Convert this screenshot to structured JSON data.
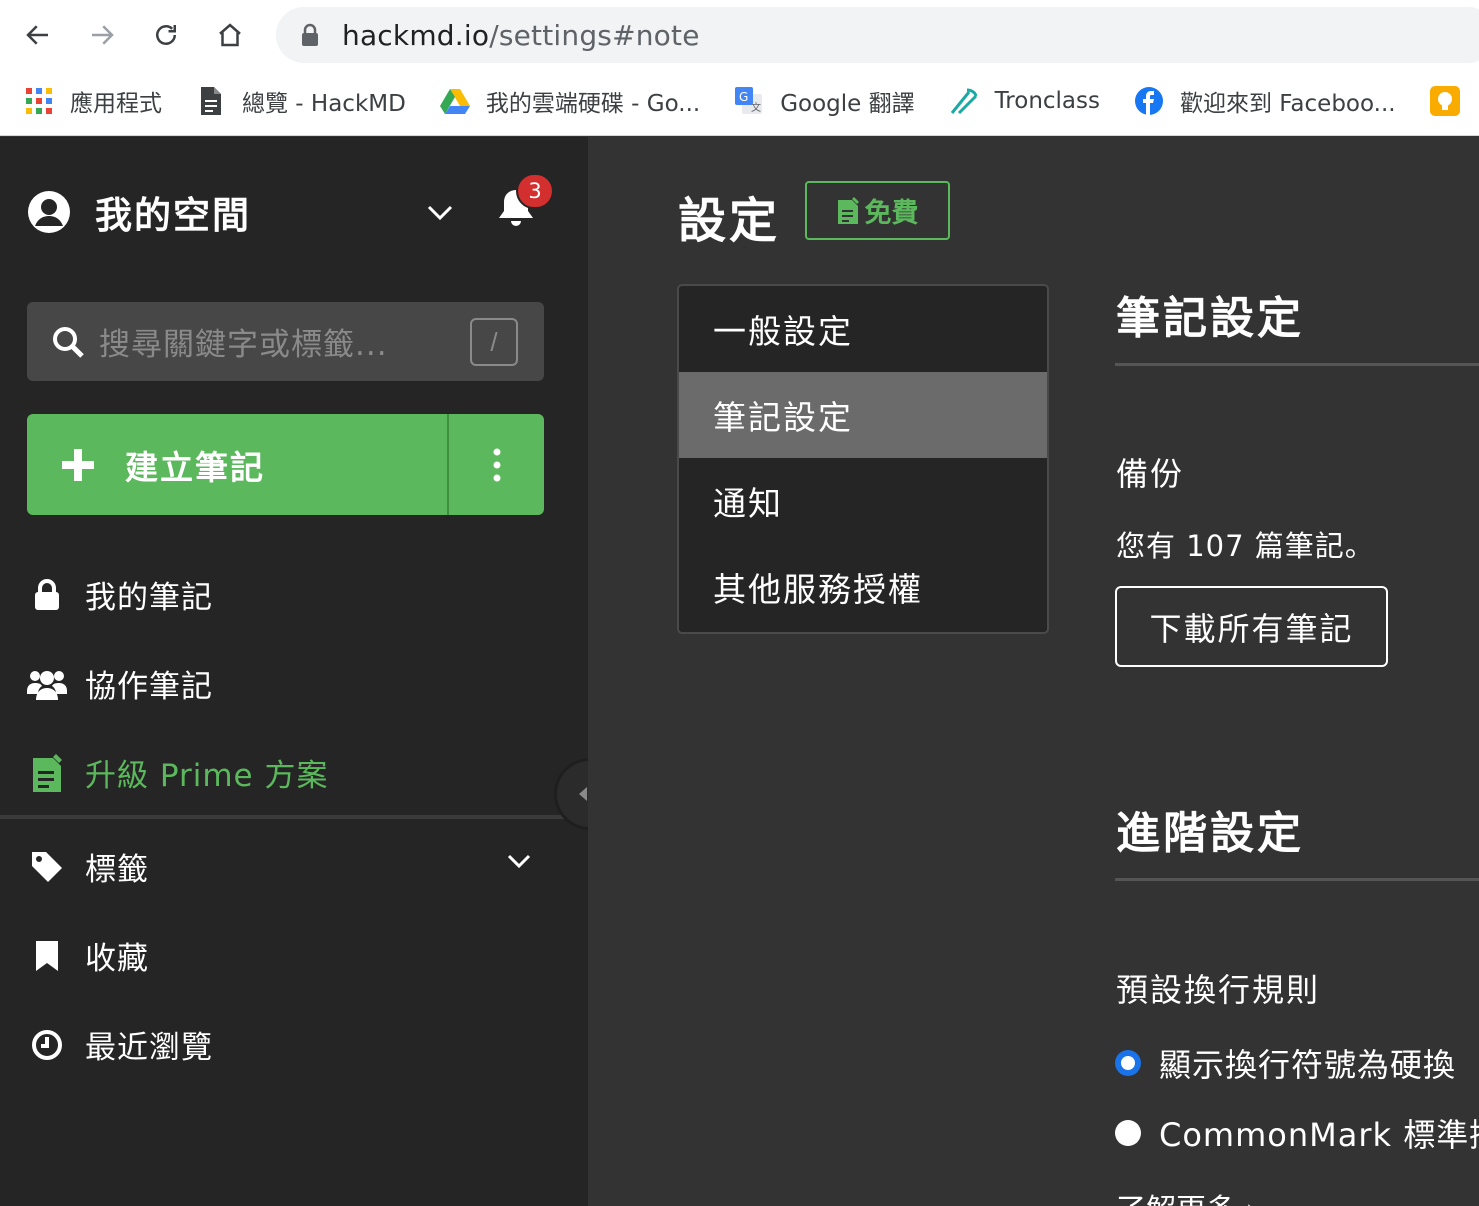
{
  "browser": {
    "url_host": "hackmd.io",
    "url_path": "/settings#note",
    "bookmarks": [
      {
        "label": "應用程式",
        "icon": "apps-grid-icon"
      },
      {
        "label": "總覽 - HackMD",
        "icon": "document-icon"
      },
      {
        "label": "我的雲端硬碟 - Go...",
        "icon": "google-drive-icon"
      },
      {
        "label": "Google 翻譯",
        "icon": "google-translate-icon"
      },
      {
        "label": "Tronclass",
        "icon": "tronclass-icon"
      },
      {
        "label": "歡迎來到 Faceboo...",
        "icon": "facebook-icon"
      }
    ]
  },
  "sidebar": {
    "workspace_title": "我的空間",
    "notification_count": "3",
    "search_placeholder": "搜尋關鍵字或標籤...",
    "search_shortcut": "/",
    "new_note_label": "建立筆記",
    "items": [
      {
        "label": "我的筆記",
        "icon": "lock-icon"
      },
      {
        "label": "協作筆記",
        "icon": "users-icon"
      },
      {
        "label": "升級 Prime 方案",
        "icon": "prime-note-icon"
      },
      {
        "label": "標籤",
        "icon": "tag-icon"
      },
      {
        "label": "收藏",
        "icon": "bookmark-icon"
      },
      {
        "label": "最近瀏覽",
        "icon": "clock-icon"
      }
    ]
  },
  "main": {
    "title": "設定",
    "plan_badge": "免費",
    "settings_nav": [
      {
        "label": "一般設定",
        "active": false
      },
      {
        "label": "筆記設定",
        "active": true
      },
      {
        "label": "通知",
        "active": false
      },
      {
        "label": "其他服務授權",
        "active": false
      }
    ],
    "note_settings": {
      "title": "筆記設定",
      "backup_label": "備份",
      "backup_text": "您有 107 篇筆記。",
      "download_button": "下載所有筆記"
    },
    "advanced_settings": {
      "title": "進階設定",
      "line_break_label": "預設換行規則",
      "options": [
        {
          "label": "顯示換行符號為硬換",
          "checked": true
        },
        {
          "label": "CommonMark 標準換",
          "checked": false
        }
      ],
      "learn_more": "了解更多 ›"
    }
  },
  "colors": {
    "accent_green": "#5cb85c",
    "sidebar_bg": "#252525",
    "main_bg": "#333333",
    "badge_red": "#d32f2f",
    "radio_blue": "#1a73e8"
  }
}
